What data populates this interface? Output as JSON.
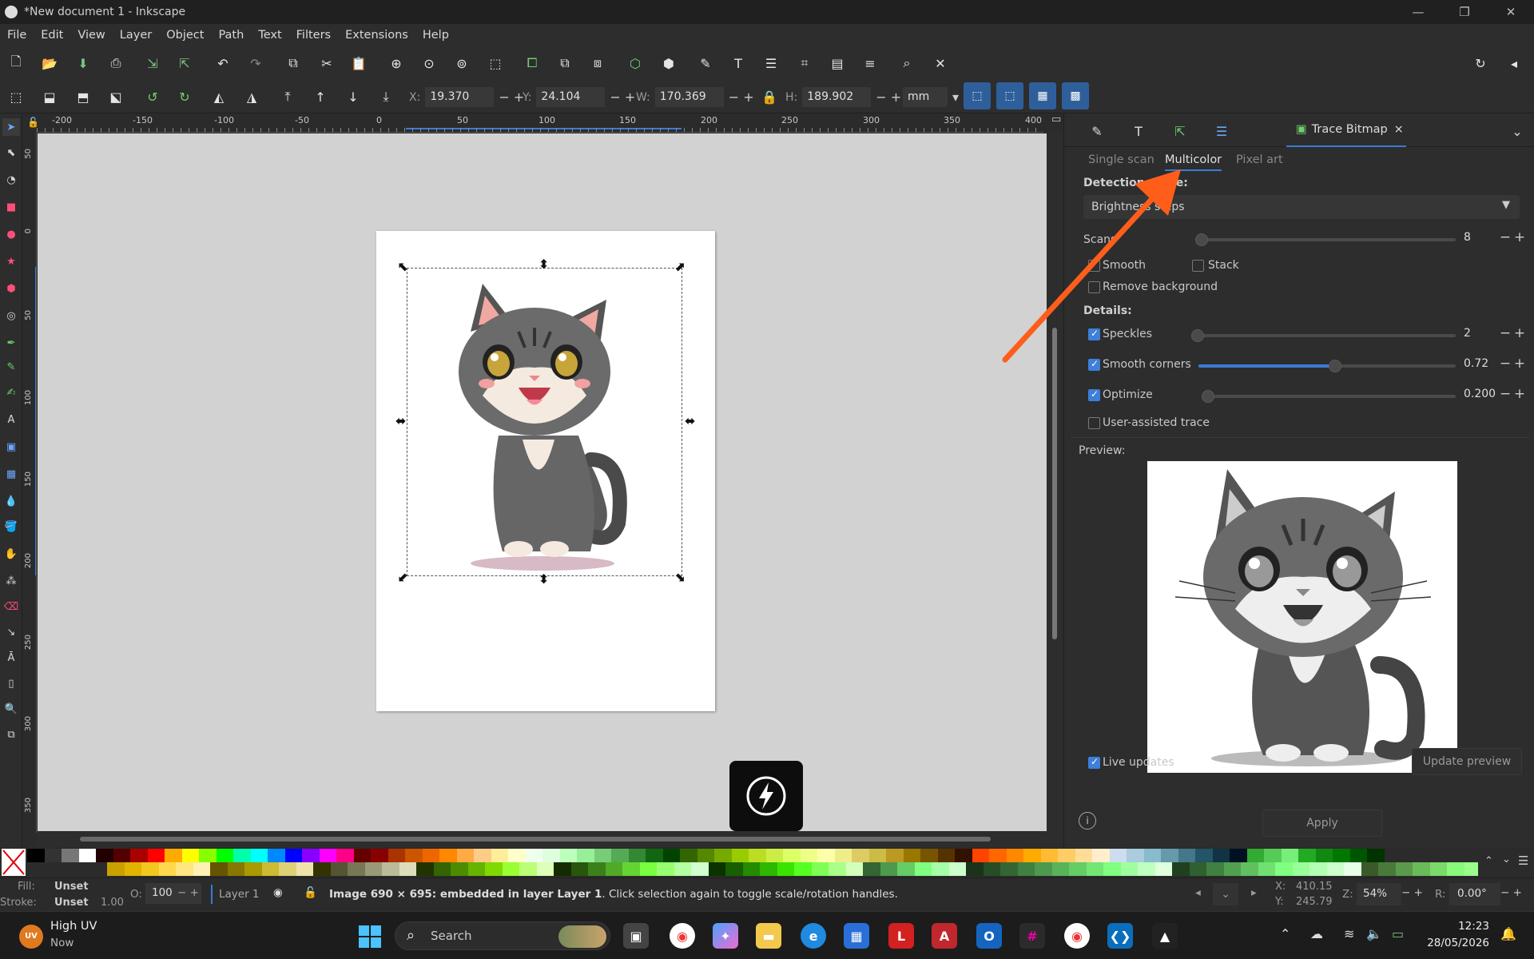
{
  "window": {
    "title": "*New document 1 - Inkscape",
    "minimize": "—",
    "restore": "❐",
    "close": "✕"
  },
  "menu": [
    "File",
    "Edit",
    "View",
    "Layer",
    "Object",
    "Path",
    "Text",
    "Filters",
    "Extensions",
    "Help"
  ],
  "toolbar": {
    "x_label": "X:",
    "x_value": "19.370",
    "y_label": "Y:",
    "y_value": "24.104",
    "w_label": "W:",
    "w_value": "170.369",
    "h_label": "H:",
    "h_value": "189.902",
    "unit": "mm"
  },
  "ruler": {
    "h_ticks": [
      "-200",
      "-150",
      "-100",
      "-50",
      "0",
      "50",
      "100",
      "150",
      "200",
      "250",
      "300",
      "350",
      "400"
    ],
    "v_ticks": [
      "50",
      "0",
      "50",
      "100",
      "150",
      "200",
      "250",
      "300",
      "350"
    ]
  },
  "panel": {
    "tab_title": "Trace Bitmap",
    "tab_close": "×",
    "subtabs": [
      "Single scan",
      "Multicolor",
      "Pixel art"
    ],
    "detection_mode_label": "Detection mode:",
    "detection_mode_value": "Brightness steps",
    "scans_label": "Scans",
    "scans_value": "8",
    "smooth_label": "Smooth",
    "stack_label": "Stack",
    "remove_bg_label": "Remove background",
    "details_label": "Details:",
    "speckles_label": "Speckles",
    "speckles_value": "2",
    "smooth_corners_label": "Smooth corners",
    "smooth_corners_value": "0.72",
    "smooth_corners_fraction": 0.53,
    "optimize_label": "Optimize",
    "optimize_value": "0.200",
    "user_assisted_label": "User-assisted trace",
    "preview_label": "Preview:",
    "live_updates_label": "Live updates",
    "update_preview_label": "Update preview",
    "apply_label": "Apply",
    "checks": {
      "smooth": false,
      "stack": false,
      "remove_bg": false,
      "speckles": true,
      "smooth_corners": true,
      "optimize": true,
      "user_assisted": false,
      "live_updates": true
    }
  },
  "status": {
    "fill_label": "Fill:",
    "fill_value": "Unset",
    "stroke_label": "Stroke:",
    "stroke_value": "Unset",
    "stroke_width": "1.00",
    "opacity_label": "O:",
    "opacity_value": "100",
    "layer_name": "Layer 1",
    "message_prefix": "Image 690 × 695: embedded in layer ",
    "message_layer": "Layer 1",
    "message_suffix": ". Click selection again to toggle scale/rotation handles.",
    "cursor_x_label": "X:",
    "cursor_x": "410.15",
    "cursor_y_label": "Y:",
    "cursor_y": "245.79",
    "zoom_label": "Z:",
    "zoom_value": "54%",
    "rotate_label": "R:",
    "rotate_value": "0.00°"
  },
  "taskbar": {
    "weather_title": "High UV",
    "weather_sub": "Now",
    "weather_badge": "UV",
    "search_placeholder": "Search",
    "time": "12:23",
    "date": "28/05/2026"
  },
  "colors": {
    "accent": "#3a7bd5",
    "annotation_arrow": "#ff5e1a"
  }
}
